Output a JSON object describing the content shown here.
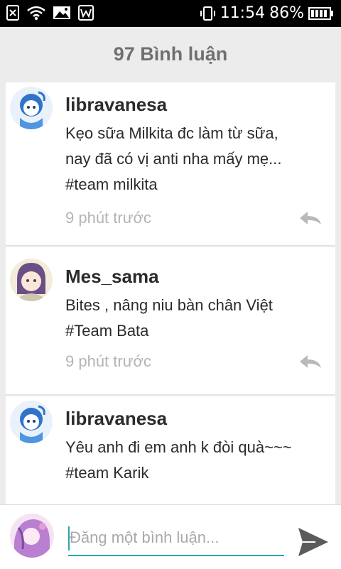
{
  "status_bar": {
    "time": "11:54",
    "battery": "86%",
    "icons": [
      "sim-missing-icon",
      "wifi-icon",
      "gallery-icon",
      "app-w-icon",
      "phone-vibrate-icon",
      "battery-icon"
    ]
  },
  "header": {
    "title": "97 Bình luận"
  },
  "comments": [
    {
      "username": "libravanesa",
      "lines": [
        "Kẹo sữa Milkita đc làm từ sữa,",
        "nay đã có vị anti nha mấy mẹ...",
        "#team milkita"
      ],
      "time": "9 phút trước"
    },
    {
      "username": "Mes_sama",
      "lines": [
        "Bites , nâng niu bàn chân Việt",
        "#Team Bata"
      ],
      "time": "9 phút trước"
    },
    {
      "username": "libravanesa",
      "lines": [
        "Yêu anh đi em anh k đòi quà~~~",
        "#team Karik"
      ],
      "time": ""
    }
  ],
  "input": {
    "placeholder": "Đăng một bình luận...",
    "value": ""
  },
  "colors": {
    "accent": "#2aa6a6",
    "header_bg": "#ececec",
    "title": "#707070",
    "timestamp": "#b4b4b4"
  }
}
